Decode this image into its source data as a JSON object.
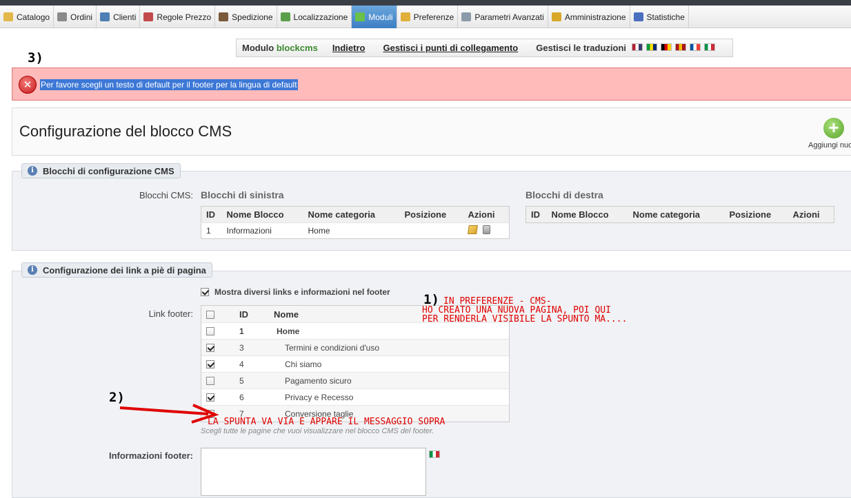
{
  "nav_tabs": [
    {
      "label": "Catalogo",
      "icon": "folder-icon",
      "color": "#e3b84a"
    },
    {
      "label": "Ordini",
      "icon": "cart-icon",
      "color": "#8a8a8a"
    },
    {
      "label": "Clienti",
      "icon": "user-icon",
      "color": "#4f7fb5"
    },
    {
      "label": "Regole Prezzo",
      "icon": "price-rules-icon",
      "color": "#c24a4a"
    },
    {
      "label": "Spedizione",
      "icon": "truck-icon",
      "color": "#7a5a3a"
    },
    {
      "label": "Localizzazione",
      "icon": "globe-icon",
      "color": "#5aa04a"
    },
    {
      "label": "Moduli",
      "icon": "puzzle-icon",
      "color": "#6ac04a",
      "active": true
    },
    {
      "label": "Preferenze",
      "icon": "preferences-icon",
      "color": "#e0b03a"
    },
    {
      "label": "Parametri Avanzati",
      "icon": "wrench-icon",
      "color": "#8a9aaa"
    },
    {
      "label": "Amministrazione",
      "icon": "key-icon",
      "color": "#d8a82a"
    },
    {
      "label": "Statistiche",
      "icon": "bar-chart-icon",
      "color": "#4a6fbf"
    }
  ],
  "module_bar": {
    "prefix": "Modulo ",
    "module": "blockcms",
    "back": "Indietro",
    "hooks": "Gestisci i punti di collegamento",
    "translations": "Gestisci le traduzioni",
    "flags": [
      {
        "name": "flag-us-icon",
        "colors": [
          "#b22234",
          "#ffffff",
          "#3c3b6e"
        ]
      },
      {
        "name": "flag-br-icon",
        "colors": [
          "#009c3b",
          "#ffdf00",
          "#002776"
        ]
      },
      {
        "name": "flag-de-icon",
        "colors": [
          "#000000",
          "#dd0000",
          "#ffce00"
        ]
      },
      {
        "name": "flag-es-icon",
        "colors": [
          "#aa151b",
          "#f1bf00",
          "#aa151b"
        ]
      },
      {
        "name": "flag-fr-icon",
        "colors": [
          "#0055a4",
          "#ffffff",
          "#ef4135"
        ]
      },
      {
        "name": "flag-it-icon",
        "colors": [
          "#009246",
          "#ffffff",
          "#ce2b37"
        ]
      }
    ]
  },
  "annotations": {
    "step3": "3)",
    "step2": "2)",
    "step1": "1)",
    "note1_line1": "IN PREFERENZE - CMS-",
    "note1_line2": "HO CREATO UNA NUOVA PAGINA, POI QUI",
    "note1_line3": "PER RENDERLA VISIBILE LA SPUNTO MA....",
    "note2": "LA SPUNTA VA VIA E APPARE IL MESSAGGIO SOPRA"
  },
  "error": {
    "message": "Per favore scegli un testo di default per il footer per la lingua di default"
  },
  "header": {
    "title": "Configurazione del blocco CMS",
    "add_label": "Aggiungi nuo"
  },
  "cms_blocks": {
    "legend": "Blocchi di configurazione CMS",
    "label": "Blocchi CMS:",
    "left": {
      "title": "Blocchi di sinistra",
      "columns": [
        "ID",
        "Nome Blocco",
        "Nome categoria",
        "Posizione",
        "Azioni"
      ],
      "rows": [
        {
          "id": "1",
          "name": "Informazioni",
          "category": "Home",
          "position": ""
        }
      ]
    },
    "right": {
      "title": "Blocchi di destra",
      "columns": [
        "ID",
        "Nome Blocco",
        "Nome categoria",
        "Posizione",
        "Azioni"
      ]
    }
  },
  "footer_links": {
    "legend": "Configurazione dei link a piè di pagina",
    "show_label": "Mostra diversi links e informazioni nel footer",
    "show_checked": true,
    "link_label": "Link footer:",
    "columns": [
      "ID",
      "Nome"
    ],
    "rows": [
      {
        "id": "1",
        "name": "Home",
        "checked": false,
        "category": true
      },
      {
        "id": "3",
        "name": "Termini e condizioni d'uso",
        "checked": true
      },
      {
        "id": "4",
        "name": "Chi siamo",
        "checked": true
      },
      {
        "id": "5",
        "name": "Pagamento sicuro",
        "checked": false
      },
      {
        "id": "6",
        "name": "Privacy e Recesso",
        "checked": true
      },
      {
        "id": "7",
        "name": "Conversione taglie",
        "checked": false
      }
    ],
    "hint": "Scegli tutte le pagine che vuoi visualizzare nel blocco CMS del footer.",
    "info_label": "Informazioni footer:"
  }
}
